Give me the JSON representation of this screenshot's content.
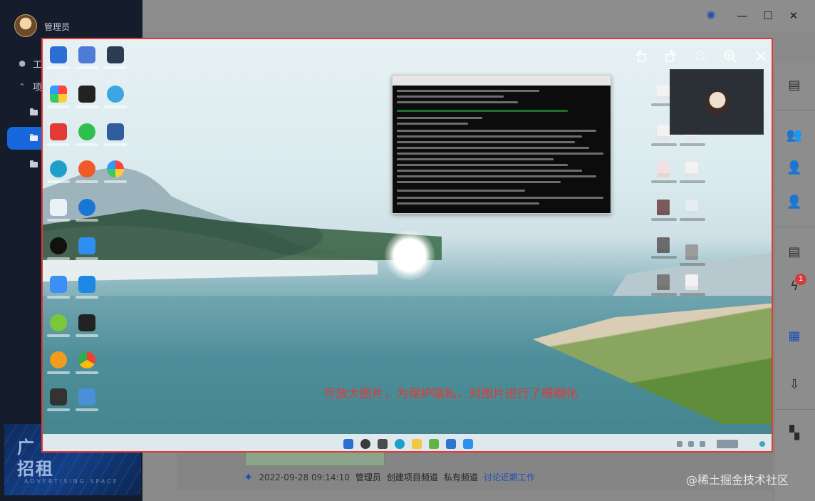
{
  "sidebar": {
    "username": "管理员",
    "nav": [
      {
        "label": "工",
        "icon": "cube-icon"
      },
      {
        "label": "项",
        "icon": "chevron-up-icon"
      }
    ],
    "ad": {
      "big_top": "广",
      "big_bottom": "招租",
      "small": "ADVERTISING SPACE"
    }
  },
  "window": {
    "bug_icon": "bug-icon",
    "minimize": "minimize-icon",
    "maximize": "maximize-icon",
    "close": "close-icon"
  },
  "viewer": {
    "notice": "可放大图片，为保护隐私，对图片进行了模糊化",
    "toolbar": [
      "rotate-left-icon",
      "rotate-right-icon",
      "zoom-out-icon",
      "zoom-in-icon",
      "close-icon"
    ]
  },
  "feed": {
    "timestamp": "2022-09-28 09:14:10",
    "actor": "管理员",
    "action": "创建项目频道",
    "channel_type": "私有频道",
    "channel_name": "讨论近期工作"
  },
  "right_rail": {
    "badge_count": "1",
    "icons": [
      "document-icon",
      "users-icon",
      "user-add-icon",
      "user-check-icon",
      "note-icon",
      "bolt-icon",
      "task-icon",
      "download-icon",
      "apps-icon"
    ]
  },
  "watermark": "@稀土掘金技术社区",
  "colors": {
    "accent": "#1668dc",
    "frame": "#e53935",
    "link": "#1d4fb8"
  }
}
